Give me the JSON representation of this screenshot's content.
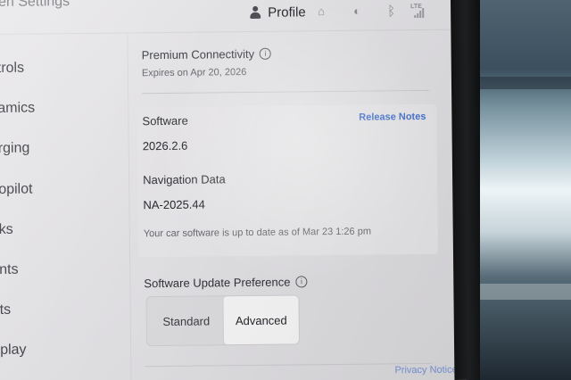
{
  "window_title": "en Settings",
  "profile": {
    "label": "Profile"
  },
  "sidebar": {
    "items": [
      {
        "label": "trols"
      },
      {
        "label": "amics"
      },
      {
        "label": "rging"
      },
      {
        "label": "opilot"
      },
      {
        "label": "ks"
      },
      {
        "label": "nts"
      },
      {
        "label": "ts"
      },
      {
        "label": "play"
      }
    ]
  },
  "connectivity": {
    "title": "Premium Connectivity",
    "info_icon": "info-icon",
    "expires": "Expires on Apr 20, 2026"
  },
  "software": {
    "label": "Software",
    "release_notes": "Release Notes",
    "version": "2026.2.6",
    "navigation_label": "Navigation Data",
    "navigation_version": "NA-2025.44",
    "status": "Your car software is up to date as of Mar 23 1:26 pm"
  },
  "update_preference": {
    "title": "Software Update Preference",
    "info_icon": "info-icon",
    "options": [
      {
        "label": "Standard",
        "selected": false
      },
      {
        "label": "Advanced",
        "selected": true
      }
    ]
  },
  "footer": {
    "partial_link": "Privacy Notice"
  },
  "icons": {
    "person": "person-icon",
    "home": "home-icon",
    "bell": "bell-icon",
    "bluetooth": "bluetooth-icon",
    "lte": "LTE",
    "signal": "signal-icon"
  },
  "colors": {
    "accent_blue": "#3e6ccf",
    "screen_bg": "#e4e3e6",
    "text_primary": "#2d2f33"
  }
}
